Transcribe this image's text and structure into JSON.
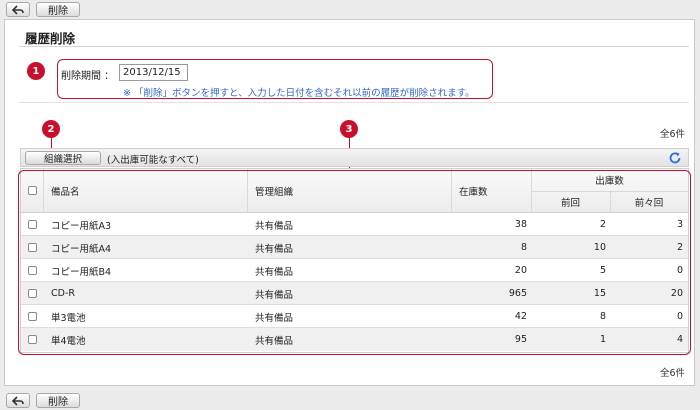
{
  "toolbar": {
    "back_icon": "back-arrow-icon",
    "delete_label": "削除"
  },
  "page": {
    "title": "履歴削除"
  },
  "form": {
    "period_label": "削除期間 ：",
    "date_value": "2013/12/15",
    "note": "※ 「削除」ボタンを押すと、入力した日付を含むそれ以前の履歴が削除されます。"
  },
  "callouts": [
    "1",
    "2",
    "3"
  ],
  "summary": {
    "total": "全6件"
  },
  "org": {
    "button_label": "組織選択",
    "scope_text": "(入出庫可能なすべて)",
    "refresh_icon": "refresh-icon"
  },
  "table": {
    "headers": {
      "name": "備品名",
      "org": "管理組織",
      "stock": "在庫数",
      "shipped": "出庫数",
      "prev": "前回",
      "prev2": "前々回"
    },
    "rows": [
      {
        "name": "コピー用紙A3",
        "org": "共有備品",
        "stock": "38",
        "prev": "2",
        "prev2": "3"
      },
      {
        "name": "コピー用紙A4",
        "org": "共有備品",
        "stock": "8",
        "prev": "10",
        "prev2": "2"
      },
      {
        "name": "コピー用紙B4",
        "org": "共有備品",
        "stock": "20",
        "prev": "5",
        "prev2": "0"
      },
      {
        "name": "CD-R",
        "org": "共有備品",
        "stock": "965",
        "prev": "15",
        "prev2": "20"
      },
      {
        "name": "単3電池",
        "org": "共有備品",
        "stock": "42",
        "prev": "8",
        "prev2": "0"
      },
      {
        "name": "単4電池",
        "org": "共有備品",
        "stock": "95",
        "prev": "1",
        "prev2": "4"
      }
    ]
  },
  "colors": {
    "accent_red": "#c8102e",
    "note_blue": "#3366cc",
    "refresh_blue": "#2f6fd6"
  }
}
